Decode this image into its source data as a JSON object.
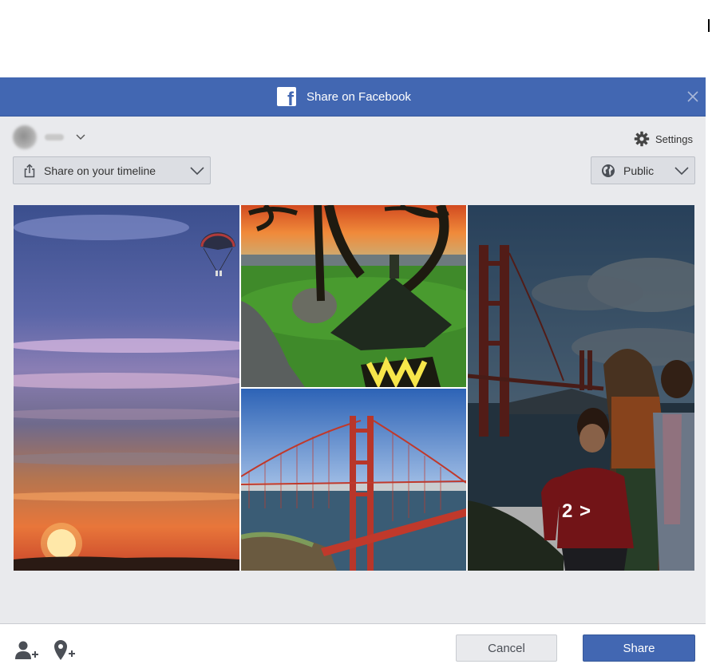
{
  "dialog": {
    "title": "Share on Facebook",
    "close_icon": "close-icon",
    "brand_color": "#4267b2"
  },
  "account": {
    "avatar_icon": "avatar",
    "name": "",
    "chevron_icon": "chevron-down-icon"
  },
  "settings": {
    "label": "Settings",
    "icon": "gear-icon"
  },
  "destination": {
    "selected": "Share on your timeline",
    "icon": "share-icon"
  },
  "privacy": {
    "selected": "Public",
    "icon": "globe-icon"
  },
  "photos": {
    "items": [
      "sunset-photo",
      "palm-lamp-photo",
      "golden-gate-bridge-photo",
      "family-bridge-photo"
    ],
    "more_label": "2 >"
  },
  "footer": {
    "tag_people_icon": "tag-people-icon",
    "add_location_icon": "add-location-icon",
    "cancel_label": "Cancel",
    "share_label": "Share"
  }
}
